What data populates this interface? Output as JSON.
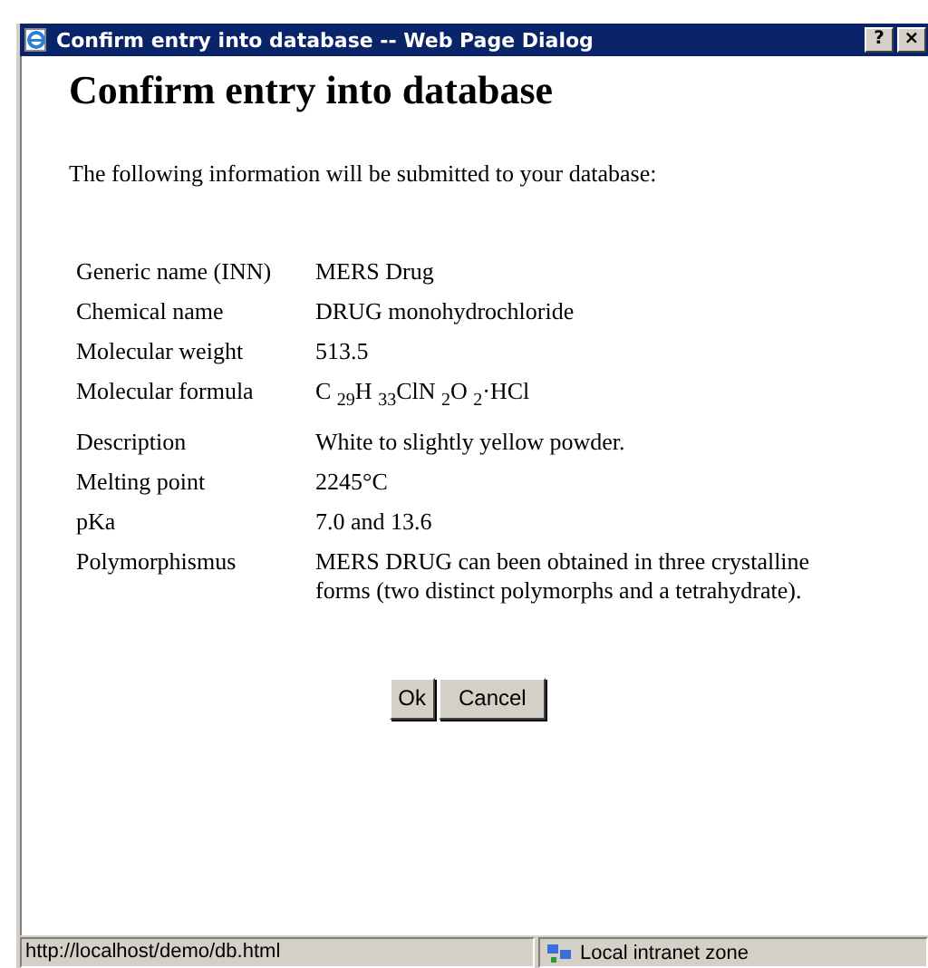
{
  "window": {
    "title": "Confirm entry into database -- Web Page Dialog",
    "controls": [
      "?",
      "×"
    ]
  },
  "heading": "Confirm entry into database",
  "intro": "The following information will be submitted to your database:",
  "fields": [
    {
      "label": "Generic name (INN)",
      "value": "MERS Drug"
    },
    {
      "label": "Chemical name",
      "value": "DRUG monohydrochloride"
    },
    {
      "label": "Molecular weight",
      "value": "513.5"
    },
    {
      "label": "Molecular formula",
      "value": "C $_{29}$H $_{33}$ClN $_{2}$O $_{2}$·HCl"
    },
    {
      "label": "Description",
      "value": "White to slightly yellow powder."
    },
    {
      "label": "Melting point",
      "value": "2245°C"
    },
    {
      "label": "pKa",
      "value": "7.0 and 13.6"
    },
    {
      "label": "Polymorphismus",
      "value": "MERS DRUG can been obtained in three crystalline forms (two distinct polymorphs and a tetrahydrate)."
    }
  ],
  "buttons": [
    "Ok",
    "Cancel"
  ],
  "status_bar": {
    "url": "http://localhost/demo/db.html",
    "zone": "Local intranet zone"
  }
}
